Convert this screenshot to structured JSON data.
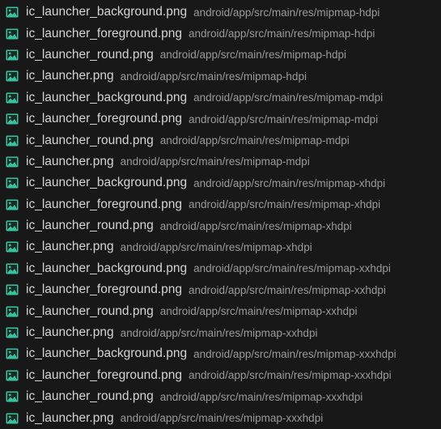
{
  "icon": "image-file-icon",
  "colors": {
    "background": "#181818",
    "icon": "#39c29f",
    "filename": "#d4d4d4",
    "path": "#9a9a9a"
  },
  "files": [
    {
      "name": "ic_launcher_background.png",
      "path": "android/app/src/main/res/mipmap-hdpi"
    },
    {
      "name": "ic_launcher_foreground.png",
      "path": "android/app/src/main/res/mipmap-hdpi"
    },
    {
      "name": "ic_launcher_round.png",
      "path": "android/app/src/main/res/mipmap-hdpi"
    },
    {
      "name": "ic_launcher.png",
      "path": "android/app/src/main/res/mipmap-hdpi"
    },
    {
      "name": "ic_launcher_background.png",
      "path": "android/app/src/main/res/mipmap-mdpi"
    },
    {
      "name": "ic_launcher_foreground.png",
      "path": "android/app/src/main/res/mipmap-mdpi"
    },
    {
      "name": "ic_launcher_round.png",
      "path": "android/app/src/main/res/mipmap-mdpi"
    },
    {
      "name": "ic_launcher.png",
      "path": "android/app/src/main/res/mipmap-mdpi"
    },
    {
      "name": "ic_launcher_background.png",
      "path": "android/app/src/main/res/mipmap-xhdpi"
    },
    {
      "name": "ic_launcher_foreground.png",
      "path": "android/app/src/main/res/mipmap-xhdpi"
    },
    {
      "name": "ic_launcher_round.png",
      "path": "android/app/src/main/res/mipmap-xhdpi"
    },
    {
      "name": "ic_launcher.png",
      "path": "android/app/src/main/res/mipmap-xhdpi"
    },
    {
      "name": "ic_launcher_background.png",
      "path": "android/app/src/main/res/mipmap-xxhdpi"
    },
    {
      "name": "ic_launcher_foreground.png",
      "path": "android/app/src/main/res/mipmap-xxhdpi"
    },
    {
      "name": "ic_launcher_round.png",
      "path": "android/app/src/main/res/mipmap-xxhdpi"
    },
    {
      "name": "ic_launcher.png",
      "path": "android/app/src/main/res/mipmap-xxhdpi"
    },
    {
      "name": "ic_launcher_background.png",
      "path": "android/app/src/main/res/mipmap-xxxhdpi"
    },
    {
      "name": "ic_launcher_foreground.png",
      "path": "android/app/src/main/res/mipmap-xxxhdpi"
    },
    {
      "name": "ic_launcher_round.png",
      "path": "android/app/src/main/res/mipmap-xxxhdpi"
    },
    {
      "name": "ic_launcher.png",
      "path": "android/app/src/main/res/mipmap-xxxhdpi"
    }
  ]
}
